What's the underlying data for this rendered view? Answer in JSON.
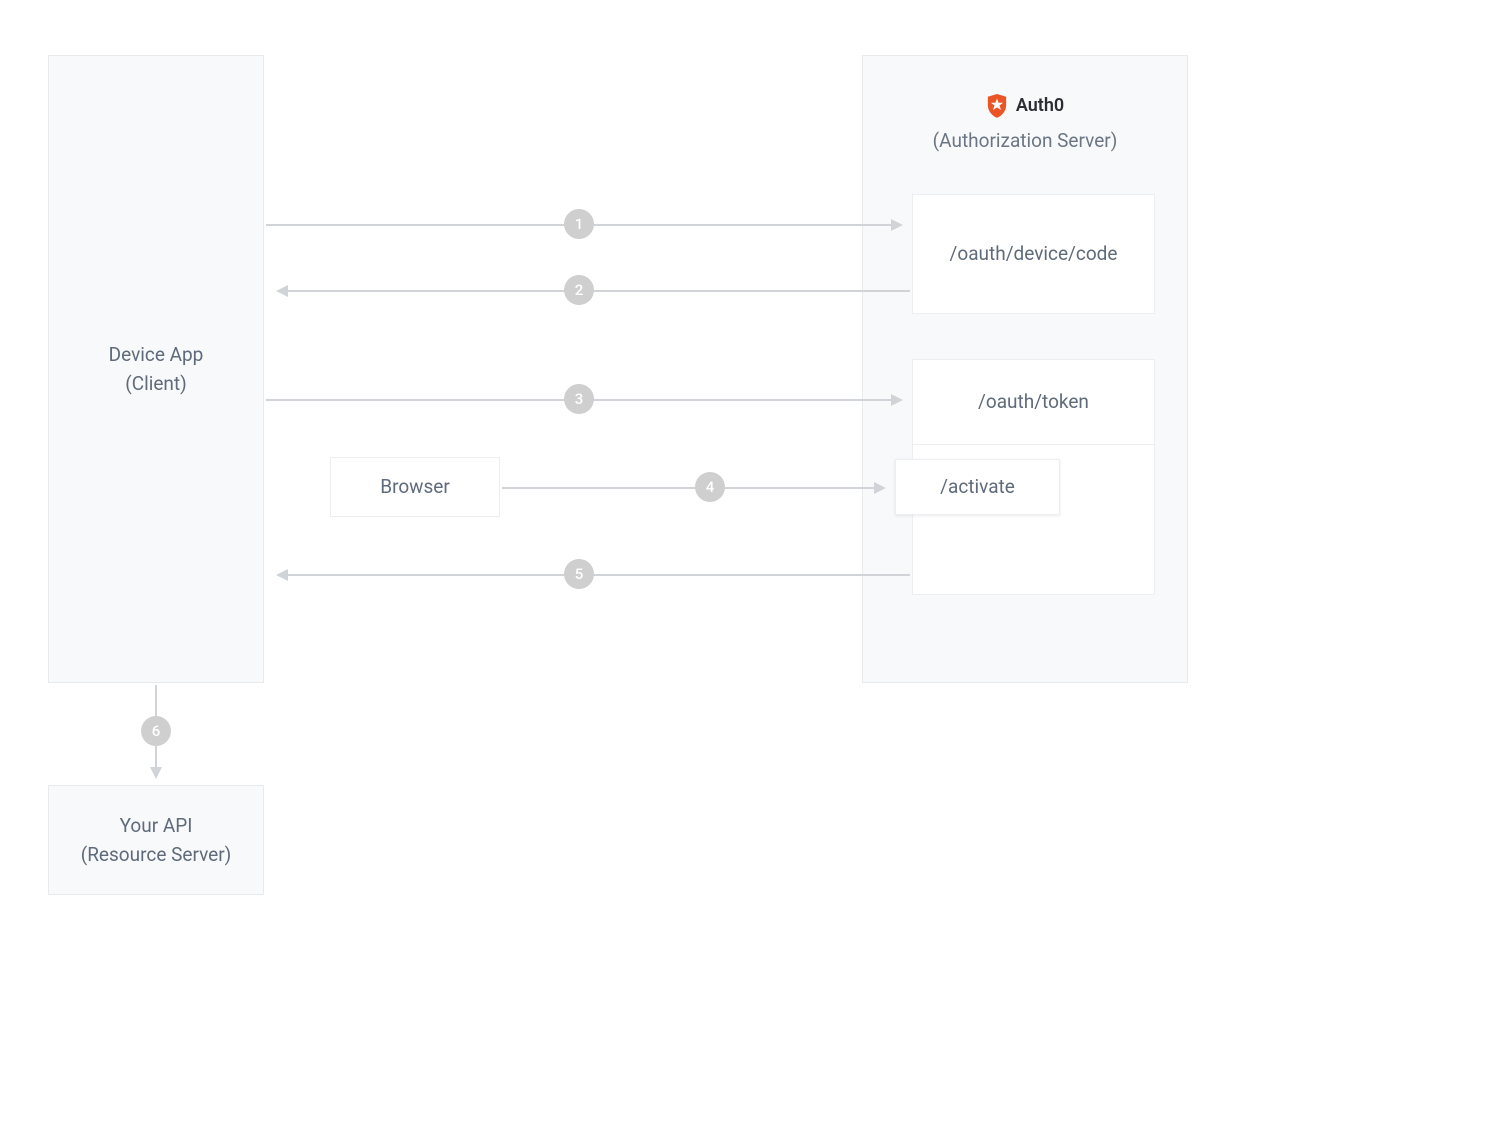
{
  "client": {
    "title": "Device App",
    "subtitle": "(Client)"
  },
  "browser": {
    "label": "Browser"
  },
  "authz": {
    "brand": "Auth0",
    "subtitle": "(Authorization Server)"
  },
  "endpoints": {
    "device_code": "/oauth/device/code",
    "token": "/oauth/token",
    "activate": "/activate"
  },
  "api": {
    "title": "Your API",
    "subtitle": "(Resource Server)"
  },
  "steps": {
    "s1": "1",
    "s2": "2",
    "s3": "3",
    "s4": "4",
    "s5": "5",
    "s6": "6"
  }
}
